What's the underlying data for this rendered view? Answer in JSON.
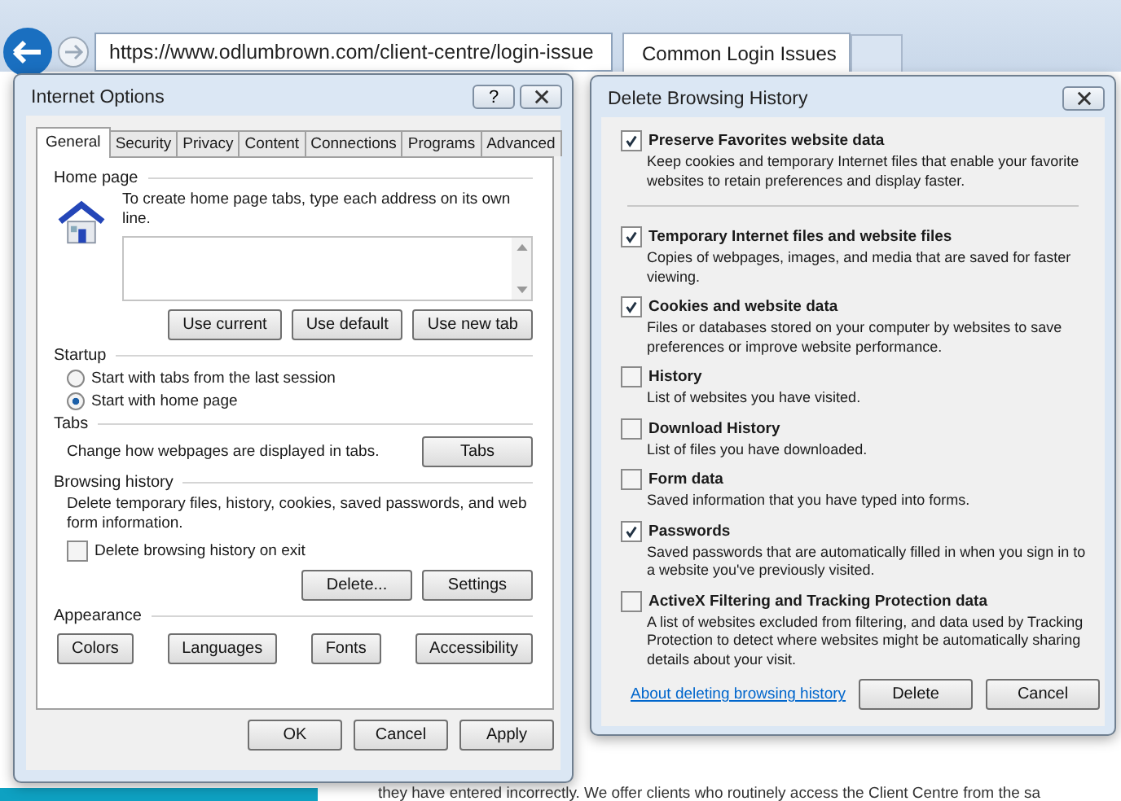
{
  "browser": {
    "address": "https://www.odlumbrown.com/client-centre/login-issue",
    "tabs": [
      {
        "title": "Common Login Issues",
        "selected": true
      }
    ]
  },
  "page": {
    "text": "they have entered incorrectly.  We offer clients who routinely access the Client Centre from the sa"
  },
  "internet_options": {
    "title": "Internet Options",
    "help": "?",
    "tabs": [
      {
        "label": "General",
        "selected": true
      },
      {
        "label": "Security",
        "selected": false
      },
      {
        "label": "Privacy",
        "selected": false
      },
      {
        "label": "Content",
        "selected": false
      },
      {
        "label": "Connections",
        "selected": false
      },
      {
        "label": "Programs",
        "selected": false
      },
      {
        "label": "Advanced",
        "selected": false
      }
    ],
    "home_page": {
      "heading": "Home page",
      "instruction": "To create home page tabs, type each address on its own line.",
      "buttons": [
        "Use current",
        "Use default",
        "Use new tab"
      ]
    },
    "startup": {
      "heading": "Startup",
      "options": [
        {
          "label": "Start with tabs from the last session",
          "selected": false
        },
        {
          "label": "Start with home page",
          "selected": true
        }
      ]
    },
    "tabs_section": {
      "heading": "Tabs",
      "description": "Change how webpages are displayed in tabs.",
      "button": "Tabs"
    },
    "browsing_history": {
      "heading": "Browsing history",
      "description": "Delete temporary files, history, cookies, saved passwords, and web form information.",
      "checkbox": {
        "label": "Delete browsing history on exit",
        "checked": false
      },
      "buttons": [
        "Delete...",
        "Settings"
      ]
    },
    "appearance": {
      "heading": "Appearance",
      "buttons": [
        "Colors",
        "Languages",
        "Fonts",
        "Accessibility"
      ]
    },
    "buttons": [
      "OK",
      "Cancel",
      "Apply"
    ]
  },
  "delete_history": {
    "title": "Delete Browsing History",
    "items": [
      {
        "label": "Preserve Favorites website data",
        "description": "Keep cookies and temporary Internet files that enable your favorite websites to retain preferences and display faster.",
        "checked": true,
        "separator_after": true
      },
      {
        "label": "Temporary Internet files and website files",
        "description": "Copies of webpages, images, and media that are saved for faster viewing.",
        "checked": true,
        "separator_after": false
      },
      {
        "label": "Cookies and website data",
        "description": "Files or databases stored on your computer by websites to save preferences or improve website performance.",
        "checked": true,
        "separator_after": false
      },
      {
        "label": "History",
        "description": "List of websites you have visited.",
        "checked": false,
        "separator_after": false
      },
      {
        "label": "Download History",
        "description": "List of files you have downloaded.",
        "checked": false,
        "separator_after": false
      },
      {
        "label": "Form data",
        "description": "Saved information that you have typed into forms.",
        "checked": false,
        "separator_after": false
      },
      {
        "label": "Passwords",
        "description": "Saved passwords that are automatically filled in when you sign in to a website you've previously visited.",
        "checked": true,
        "separator_after": false
      },
      {
        "label": "ActiveX Filtering and Tracking Protection data",
        "description": "A list of websites excluded from filtering, and data used by Tracking Protection to detect where websites might be automatically sharing details about your visit.",
        "checked": false,
        "separator_after": false
      }
    ],
    "link": "About deleting browsing history",
    "buttons": [
      "Delete",
      "Cancel"
    ]
  }
}
